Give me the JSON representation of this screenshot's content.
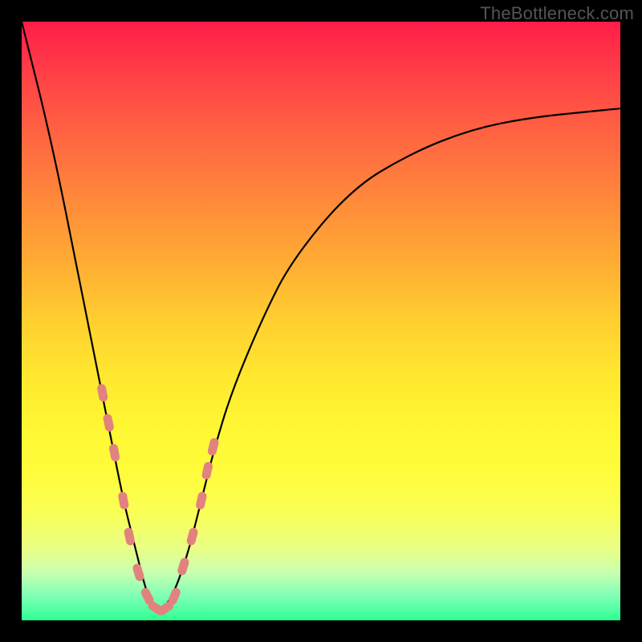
{
  "watermark": "TheBottleneck.com",
  "chart_data": {
    "type": "line",
    "title": "",
    "xlabel": "",
    "ylabel": "",
    "xlim": [
      0,
      1
    ],
    "ylim": [
      0,
      1
    ],
    "series": [
      {
        "name": "bottleneck-curve",
        "x": [
          0.0,
          0.05,
          0.1,
          0.13,
          0.15,
          0.17,
          0.19,
          0.205,
          0.215,
          0.225,
          0.235,
          0.245,
          0.26,
          0.28,
          0.3,
          0.32,
          0.35,
          0.4,
          0.45,
          0.55,
          0.65,
          0.75,
          0.85,
          0.95,
          1.0
        ],
        "y": [
          1.0,
          0.8,
          0.55,
          0.4,
          0.3,
          0.2,
          0.12,
          0.06,
          0.03,
          0.02,
          0.02,
          0.03,
          0.06,
          0.12,
          0.2,
          0.28,
          0.38,
          0.5,
          0.6,
          0.72,
          0.78,
          0.82,
          0.84,
          0.85,
          0.855
        ]
      }
    ],
    "markers": {
      "name": "highlighted-range-beads",
      "x": [
        0.135,
        0.145,
        0.155,
        0.17,
        0.18,
        0.195,
        0.21,
        0.225,
        0.24,
        0.255,
        0.27,
        0.285,
        0.3,
        0.31,
        0.32
      ],
      "y": [
        0.38,
        0.33,
        0.28,
        0.2,
        0.14,
        0.08,
        0.04,
        0.02,
        0.02,
        0.04,
        0.09,
        0.14,
        0.2,
        0.25,
        0.29
      ]
    },
    "background_gradient": {
      "top_color": "#ff1d4a",
      "middle_color": "#fff733",
      "bottom_color": "#2eff91"
    }
  }
}
